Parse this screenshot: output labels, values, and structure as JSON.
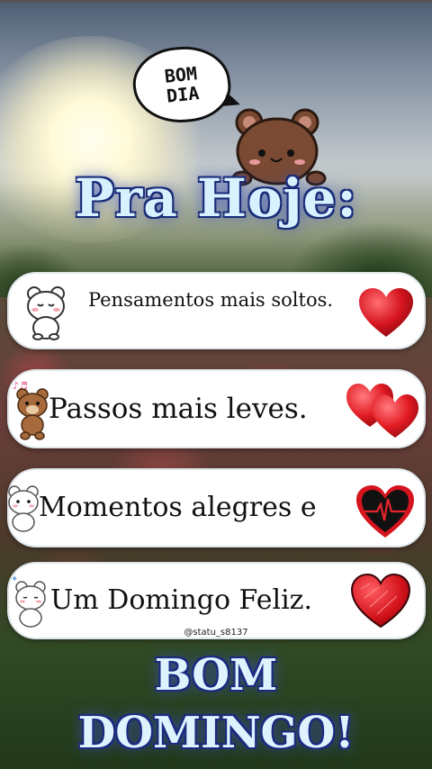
{
  "bubble": {
    "text": "BOM\nDIA"
  },
  "title": "Pra Hoje:",
  "cards": [
    {
      "text": "Pensamentos mais soltos.",
      "left_icon": "white-bear-icon",
      "right_icon": "red-heart-icon"
    },
    {
      "text": "Passos mais leves.",
      "left_icon": "brown-bear-music-icon",
      "right_icon": "double-heart-icon"
    },
    {
      "text": "Momentos alegres e",
      "left_icon": "white-bear-icon",
      "right_icon": "heartbeat-heart-icon"
    },
    {
      "text": "Um Domingo Feliz.",
      "left_icon": "white-bear-icon",
      "right_icon": "sketch-heart-icon"
    }
  ],
  "credit": "@statu_s8137",
  "footer": {
    "line1": "BOM",
    "line2": "DOMINGO!"
  },
  "colors": {
    "title_fill": "#d7f1ff",
    "title_outline": "#1b2d7a",
    "heart_red": "#d5141e"
  }
}
